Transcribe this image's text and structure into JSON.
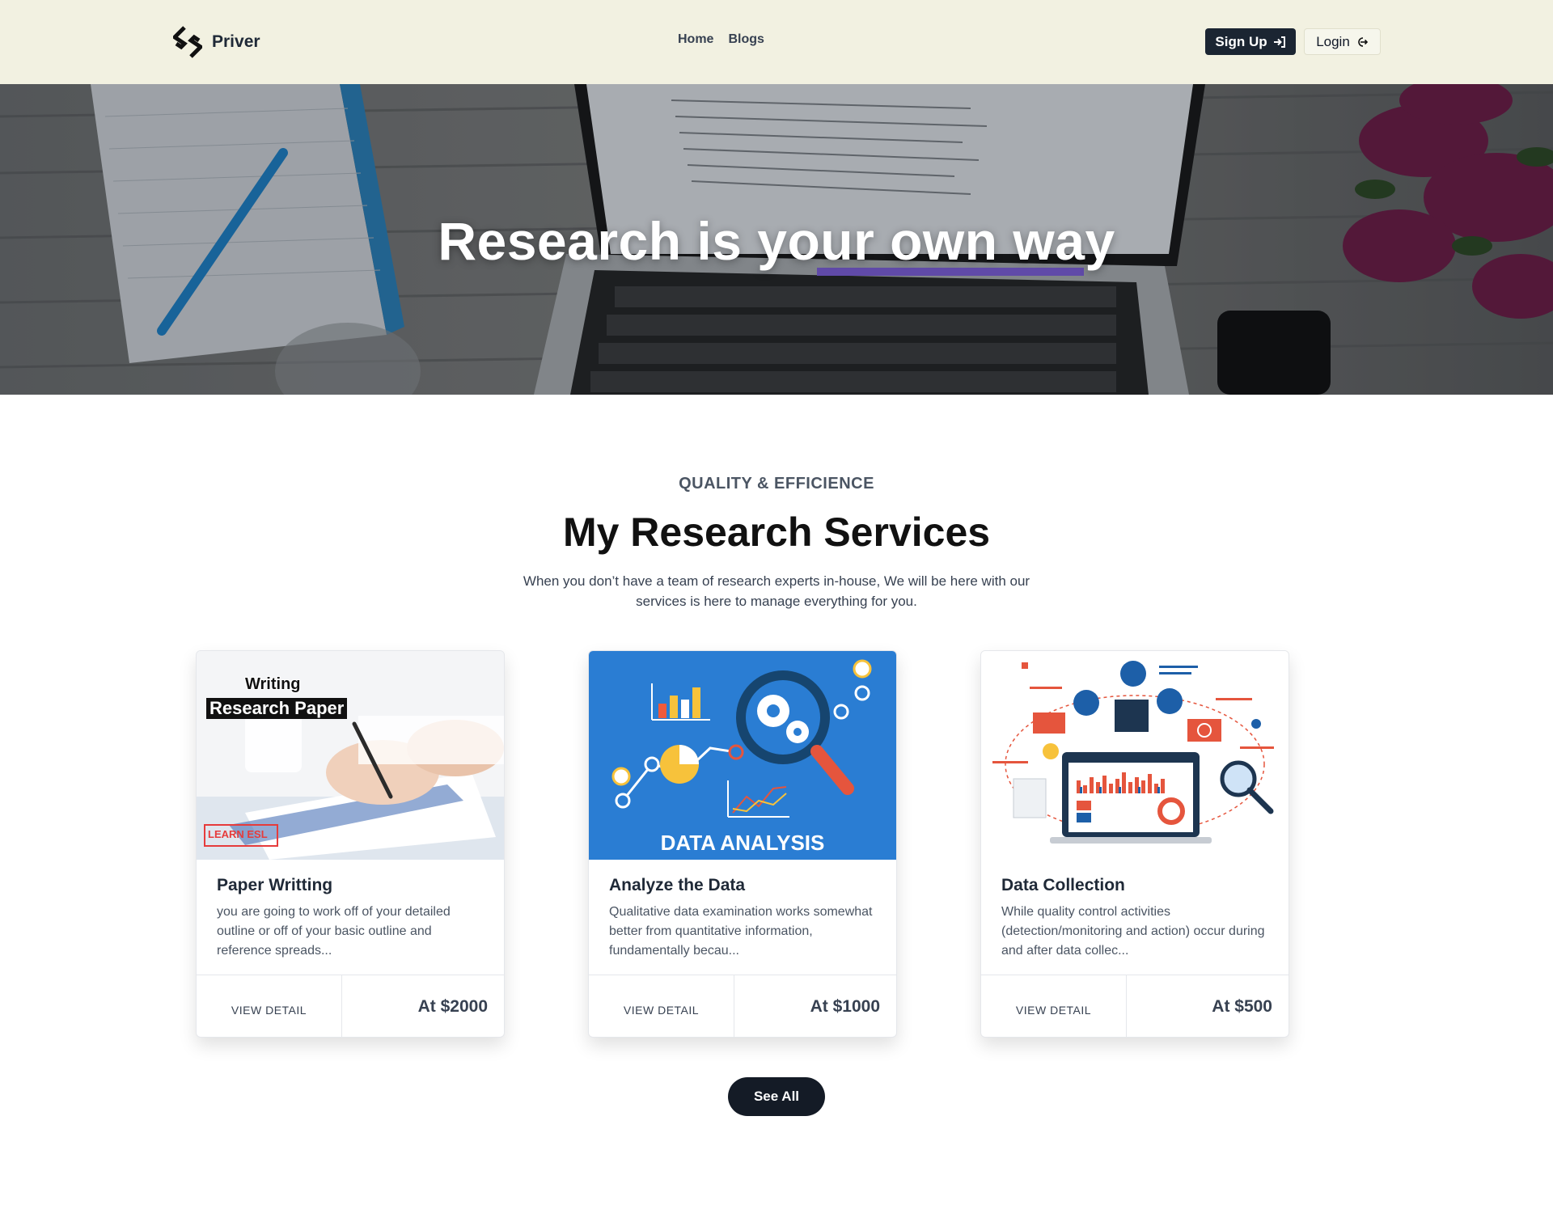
{
  "navbar": {
    "brand": "Priver",
    "links": [
      "Home",
      "Blogs"
    ],
    "signup_label": "Sign Up",
    "login_label": "Login"
  },
  "hero": {
    "title": "Research is your own way"
  },
  "services": {
    "eyebrow": "QUALITY & EFFICIENCE",
    "title": "My Research Services",
    "description": "When you don’t have a team of research experts in-house, We will be here with our services is here to manage everything for you.",
    "cards": [
      {
        "title": "Paper Writting",
        "text": "you are going to work off of your detailed outline or off of your basic outline and reference spreads...",
        "view_label": "VIEW DETAIL",
        "price": "At $2000",
        "image_caption_1": "Writing",
        "image_caption_2": "Research Paper",
        "image_badge": "LEARN ESL"
      },
      {
        "title": "Analyze the Data",
        "text": "Qualitative data examination works somewhat better from quantitative information, fundamentally becau...",
        "view_label": "VIEW DETAIL",
        "price": "At $1000",
        "image_caption": "DATA ANALYSIS"
      },
      {
        "title": "Data Collection",
        "text": "While quality control activities (detection/monitoring and action) occur during and after data collec...",
        "view_label": "VIEW DETAIL",
        "price": "At $500"
      }
    ],
    "see_all_label": "See All"
  },
  "colors": {
    "navbar_bg": "#f2f1e1",
    "primary_dark": "#1b2532",
    "data_analysis_blue": "#2a7dd3"
  }
}
